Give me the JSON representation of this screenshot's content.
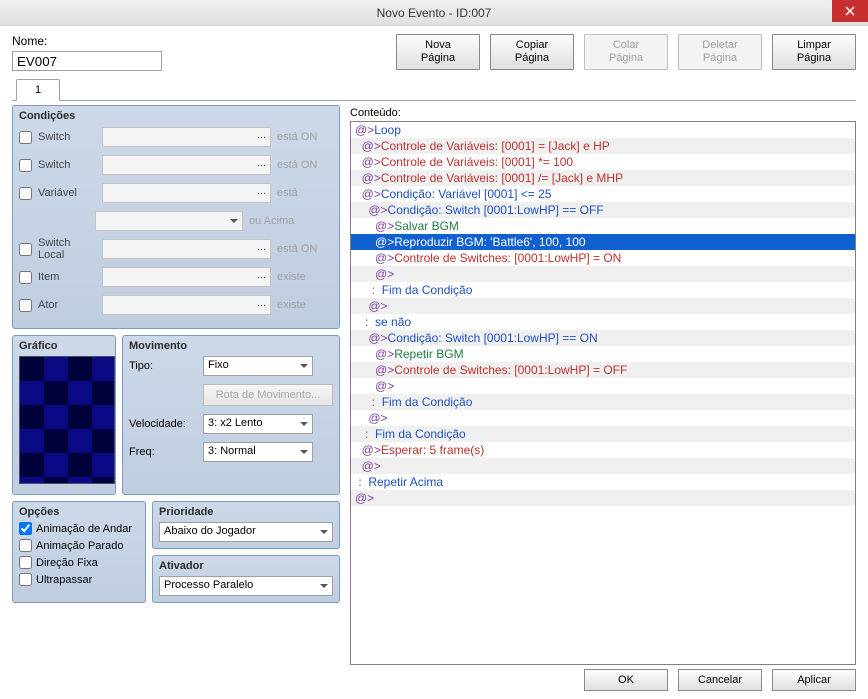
{
  "title": "Novo Evento - ID:007",
  "name_label": "Nome:",
  "name_value": "EV007",
  "page_buttons": {
    "new": "Nova\nPágina",
    "copy": "Copiar\nPágina",
    "paste": "Colar\nPágina",
    "delete": "Deletar\nPágina",
    "clear": "Limpar\nPágina"
  },
  "tabs": [
    "1"
  ],
  "conditions": {
    "title": "Condições",
    "rows": [
      {
        "label": "Switch",
        "suffix": "está ON"
      },
      {
        "label": "Switch",
        "suffix": "está ON"
      },
      {
        "label": "Variável",
        "suffix": "está"
      },
      {
        "label": "",
        "suffix": "ou Acima",
        "extra": true
      },
      {
        "label": "Switch Local",
        "suffix": "está ON"
      },
      {
        "label": "Item",
        "suffix": "existe"
      },
      {
        "label": "Ator",
        "suffix": "existe"
      }
    ]
  },
  "grafico": {
    "title": "Gráfico"
  },
  "movimento": {
    "title": "Movimento",
    "tipo_label": "Tipo:",
    "tipo_value": "Fixo",
    "rota_btn": "Rota de Movimento...",
    "vel_label": "Velocidade:",
    "vel_value": "3: x2 Lento",
    "freq_label": "Freq:",
    "freq_value": "3: Normal"
  },
  "opcoes": {
    "title": "Opções",
    "items": [
      {
        "label": "Animação de Andar",
        "checked": true
      },
      {
        "label": "Animação Parado",
        "checked": false
      },
      {
        "label": "Direção Fixa",
        "checked": false
      },
      {
        "label": "Ultrapassar",
        "checked": false
      }
    ]
  },
  "prioridade": {
    "title": "Prioridade",
    "value": "Abaixo do Jogador"
  },
  "ativador": {
    "title": "Ativador",
    "value": "Processo Paralelo"
  },
  "conteudo_label": "Conteúdo:",
  "commands": [
    {
      "indent": 0,
      "at": true,
      "cls": "blue",
      "text": "Loop"
    },
    {
      "indent": 1,
      "at": true,
      "cls": "red",
      "text": "Controle de Variáveis: [0001] = [Jack] e HP"
    },
    {
      "indent": 1,
      "at": true,
      "cls": "red",
      "text": "Controle de Variáveis: [0001] *= 100"
    },
    {
      "indent": 1,
      "at": true,
      "cls": "red",
      "text": "Controle de Variáveis: [0001] /= [Jack] e MHP"
    },
    {
      "indent": 1,
      "at": true,
      "cls": "blue",
      "text": "Condição: Variável [0001] <= 25"
    },
    {
      "indent": 2,
      "at": true,
      "cls": "blue",
      "text": "Condição: Switch [0001:LowHP] == OFF"
    },
    {
      "indent": 3,
      "at": true,
      "cls": "green",
      "text": "Salvar BGM"
    },
    {
      "indent": 3,
      "at": true,
      "cls": "green",
      "text": "Reproduzir BGM: 'Battle6', 100, 100",
      "selected": true
    },
    {
      "indent": 3,
      "at": true,
      "cls": "red",
      "text": "Controle de Switches: [0001:LowHP] = ON"
    },
    {
      "indent": 3,
      "at": true,
      "cls": "black",
      "text": ""
    },
    {
      "indent": 2,
      "colon": true,
      "cls": "blue",
      "text": "Fim da Condição"
    },
    {
      "indent": 2,
      "at": true,
      "cls": "black",
      "text": ""
    },
    {
      "indent": 1,
      "colon": true,
      "cls": "blue",
      "text": "se não"
    },
    {
      "indent": 2,
      "at": true,
      "cls": "blue",
      "text": "Condição: Switch [0001:LowHP] == ON"
    },
    {
      "indent": 3,
      "at": true,
      "cls": "green",
      "text": "Repetir BGM"
    },
    {
      "indent": 3,
      "at": true,
      "cls": "red",
      "text": "Controle de Switches: [0001:LowHP] = OFF"
    },
    {
      "indent": 3,
      "at": true,
      "cls": "black",
      "text": ""
    },
    {
      "indent": 2,
      "colon": true,
      "cls": "blue",
      "text": "Fim da Condição"
    },
    {
      "indent": 2,
      "at": true,
      "cls": "black",
      "text": ""
    },
    {
      "indent": 1,
      "colon": true,
      "cls": "blue",
      "text": "Fim da Condição"
    },
    {
      "indent": 1,
      "at": true,
      "cls": "red",
      "text": "Esperar: 5 frame(s)"
    },
    {
      "indent": 1,
      "at": true,
      "cls": "black",
      "text": ""
    },
    {
      "indent": 0,
      "colon": true,
      "cls": "blue",
      "text": "Repetir Acima"
    },
    {
      "indent": 0,
      "at": true,
      "cls": "black",
      "text": ""
    }
  ],
  "footer": {
    "ok": "OK",
    "cancel": "Cancelar",
    "apply": "Aplicar"
  }
}
